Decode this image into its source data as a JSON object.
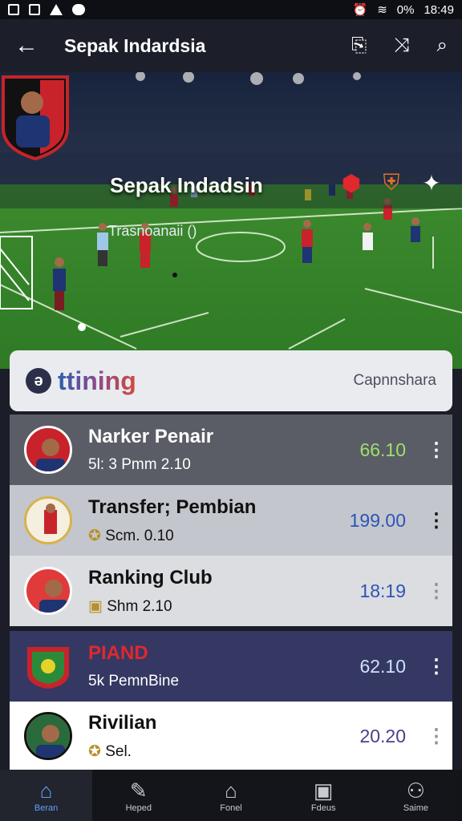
{
  "status": {
    "battery": "0%",
    "time": "18:49"
  },
  "appbar": {
    "title": "Sepak Indardsia"
  },
  "hero": {
    "team": "Sepak Indadsin",
    "subtitle": "Trasnoanaii ()"
  },
  "panel": {
    "brand": "ttining",
    "caption": "Capnnshara"
  },
  "list": [
    {
      "title": "Narker Penair",
      "subtitle": "5l: 3 Pmm 2.10",
      "value": "66.10",
      "value_color": "#9fe06a"
    },
    {
      "title": "Transfer; Pembian",
      "subtitle": "Scm. 0.10",
      "value": "199.00",
      "value_color": "#2c54b8"
    },
    {
      "title": "Ranking Club",
      "subtitle": "Shm 2.10",
      "value": "18:19",
      "value_color": "#2c54b8"
    },
    {
      "title": "PIAND",
      "subtitle": "5k PemnBine",
      "value": "62.10",
      "value_color": "#cfe0ff"
    },
    {
      "title": "Rivilian",
      "subtitle": "Sel.",
      "value": "20.20",
      "value_color": "#4a3f8a"
    }
  ],
  "nav": [
    {
      "label": "Beran",
      "icon": "home-icon"
    },
    {
      "label": "Heped",
      "icon": "edit-icon"
    },
    {
      "label": "Fonel",
      "icon": "house-icon"
    },
    {
      "label": "Fdeus",
      "icon": "card-icon"
    },
    {
      "label": "Saime",
      "icon": "person-icon"
    }
  ]
}
